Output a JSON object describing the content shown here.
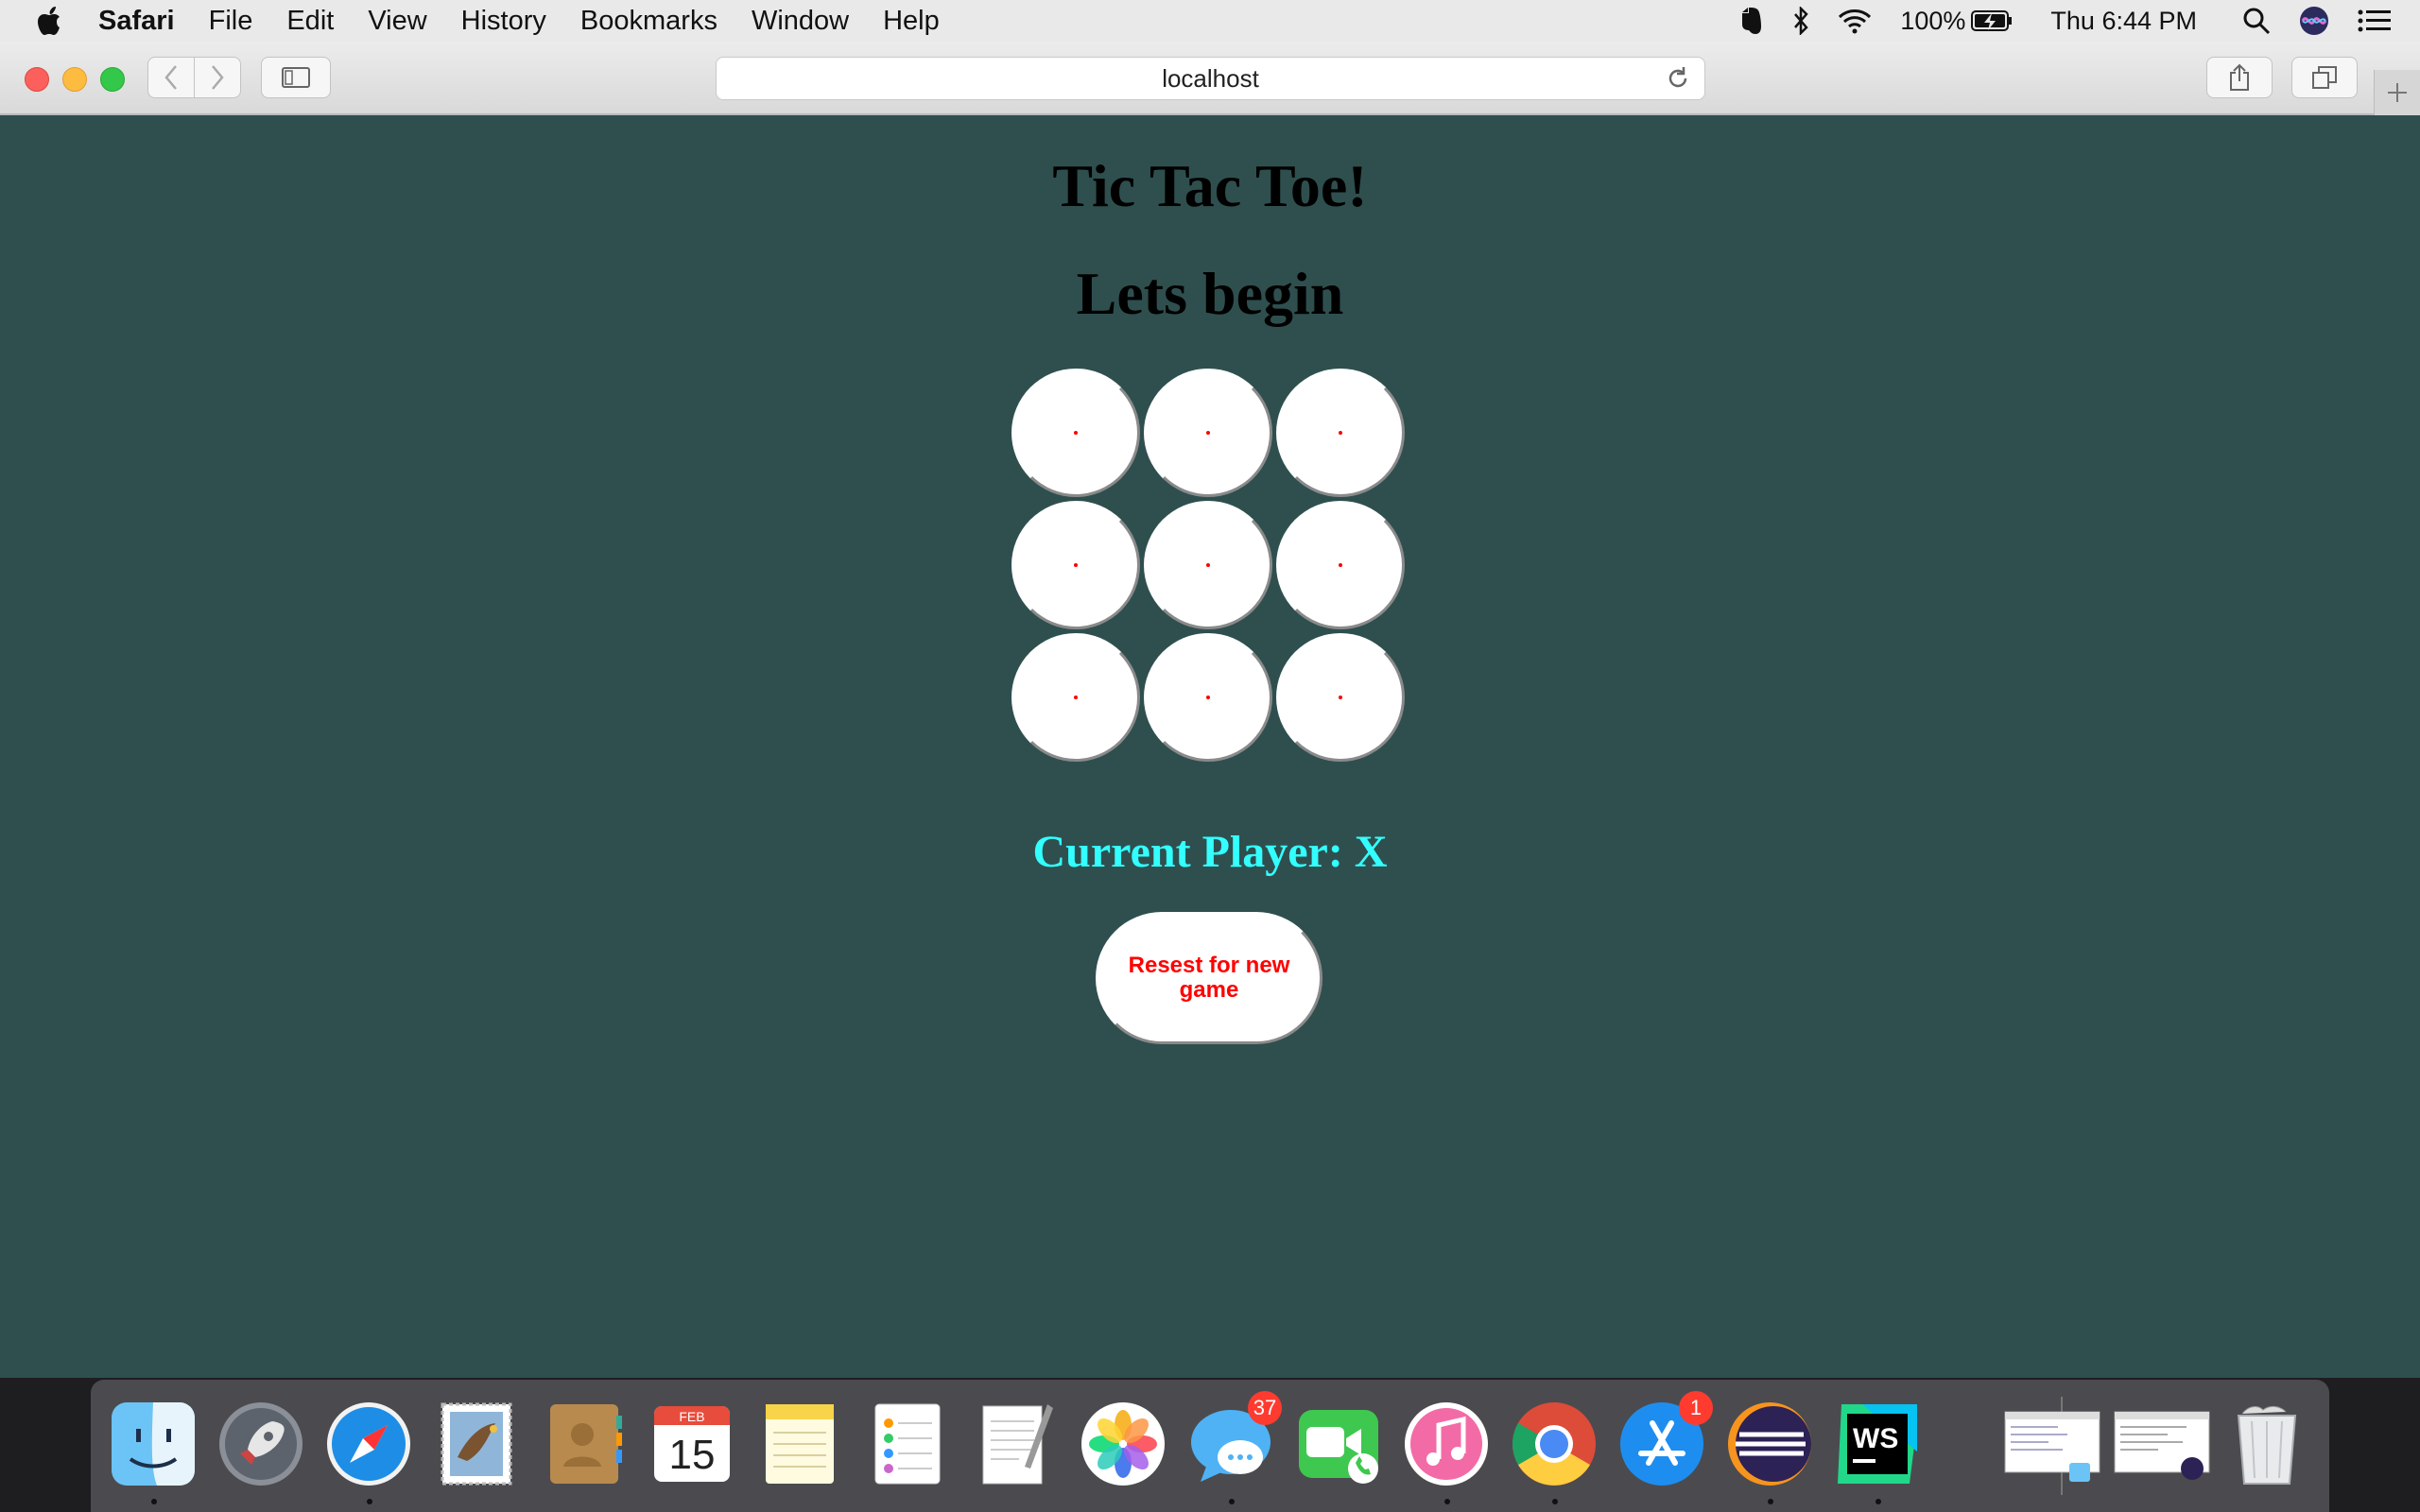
{
  "menubar": {
    "app_name": "Safari",
    "items": [
      "File",
      "Edit",
      "View",
      "History",
      "Bookmarks",
      "Window",
      "Help"
    ],
    "battery": "100%",
    "clock": "Thu 6:44 PM"
  },
  "browser": {
    "url": "localhost"
  },
  "page": {
    "title": "Tic Tac Toe!",
    "subtitle": "Lets begin",
    "board_cells": [
      "",
      "",
      "",
      "",
      "",
      "",
      "",
      "",
      ""
    ],
    "current_player": "Current Player: X",
    "reset_label": "Resest for new game",
    "colors": {
      "background": "#2f4f4f",
      "current_player": "#33ffff",
      "reset_text": "#ff0000"
    }
  },
  "dock": {
    "apps": [
      {
        "name": "Finder",
        "icon": "finder-icon",
        "running": true
      },
      {
        "name": "Launchpad",
        "icon": "rocket-icon",
        "running": false
      },
      {
        "name": "Safari",
        "icon": "compass-icon",
        "running": true
      },
      {
        "name": "Mail",
        "icon": "stamp-icon",
        "running": false
      },
      {
        "name": "Contacts",
        "icon": "address-book-icon",
        "running": false
      },
      {
        "name": "Calendar",
        "icon": "calendar-icon",
        "running": false,
        "month": "FEB",
        "day": "15"
      },
      {
        "name": "Notes",
        "icon": "notepad-icon",
        "running": false
      },
      {
        "name": "Reminders",
        "icon": "checklist-icon",
        "running": false
      },
      {
        "name": "TextEdit",
        "icon": "pen-paper-icon",
        "running": false
      },
      {
        "name": "Photos",
        "icon": "flower-icon",
        "running": false
      },
      {
        "name": "Messages",
        "icon": "chat-bubble-icon",
        "running": true,
        "badge": "37"
      },
      {
        "name": "FaceTime",
        "icon": "video-camera-icon",
        "running": false
      },
      {
        "name": "iTunes",
        "icon": "music-note-icon",
        "running": true
      },
      {
        "name": "Chrome",
        "icon": "chrome-icon",
        "running": true
      },
      {
        "name": "App Store",
        "icon": "app-store-icon",
        "running": false,
        "badge": "1"
      },
      {
        "name": "Eclipse",
        "icon": "eclipse-icon",
        "running": true
      },
      {
        "name": "WebStorm",
        "icon": "webstorm-icon",
        "running": true
      }
    ],
    "ws_label": "WS"
  }
}
